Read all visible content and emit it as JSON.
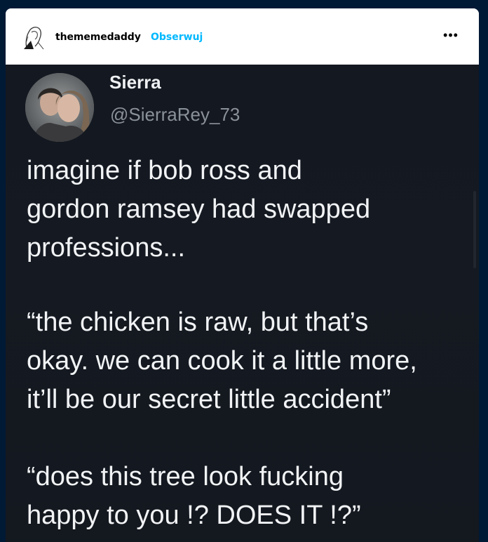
{
  "header": {
    "username": "thememedaddy",
    "follow_label": "Obserwuj",
    "more_label": "•••"
  },
  "tweet": {
    "name": "Sierra",
    "handle": "@SierraRey_73",
    "paragraph1": [
      "imagine if bob ross and",
      "gordon ramsey had swapped",
      "professions..."
    ],
    "paragraph2": [
      "“the chicken is raw, but that’s",
      "okay. we can cook it a little more,",
      "it’ll be our secret little accident”"
    ],
    "paragraph3": [
      "“does this tree look fucking",
      "happy to you !? DOES IT !?”"
    ]
  },
  "colors": {
    "page_background": "#001935",
    "follow_accent": "#00b8ff",
    "tweet_background": "#14181f"
  },
  "icons": {
    "avatar": "sketch-avatar-icon",
    "more": "more-options-icon"
  }
}
